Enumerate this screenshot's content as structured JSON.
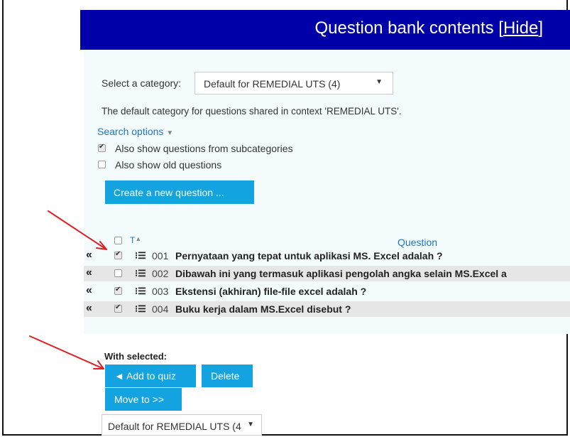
{
  "header": {
    "title": "Question bank contents",
    "hide_open": "[",
    "hide_link": "Hide",
    "hide_close": "]"
  },
  "category": {
    "label": "Select a category:",
    "selected": "Default for REMEDIAL UTS (4)",
    "description": "The default category for questions shared in context 'REMEDIAL UTS'."
  },
  "search": {
    "label": "Search options",
    "options": [
      {
        "label": "Also show questions from subcategories",
        "checked": true
      },
      {
        "label": "Also show old questions",
        "checked": false
      }
    ]
  },
  "create_button": "Create a new question ...",
  "table": {
    "type_header": "T",
    "sort_arrow": "▲",
    "question_header": "Question",
    "rows": [
      {
        "num": "001",
        "text": "Pernyataan yang tepat untuk aplikasi MS. Excel adalah ?",
        "checked": true
      },
      {
        "num": "002",
        "text": "Dibawah ini yang termasuk aplikasi pengolah angka selain MS.Excel a",
        "checked": false
      },
      {
        "num": "003",
        "text": "Ekstensi (akhiran) file-file excel adalah ?",
        "checked": true
      },
      {
        "num": "004",
        "text": "Buku kerja dalam MS.Excel disebut ?",
        "checked": true
      }
    ]
  },
  "with_selected": {
    "label": "With selected:",
    "add_button": "◄ Add to quiz",
    "delete_button": "Delete",
    "move_button": "Move to >>",
    "move_select": "Default for REMEDIAL UTS (4"
  },
  "colors": {
    "header_bg": "#0000a8",
    "button_bg": "#12a3e0",
    "link": "#1a76c5",
    "annotation_arrow": "#e02020"
  }
}
